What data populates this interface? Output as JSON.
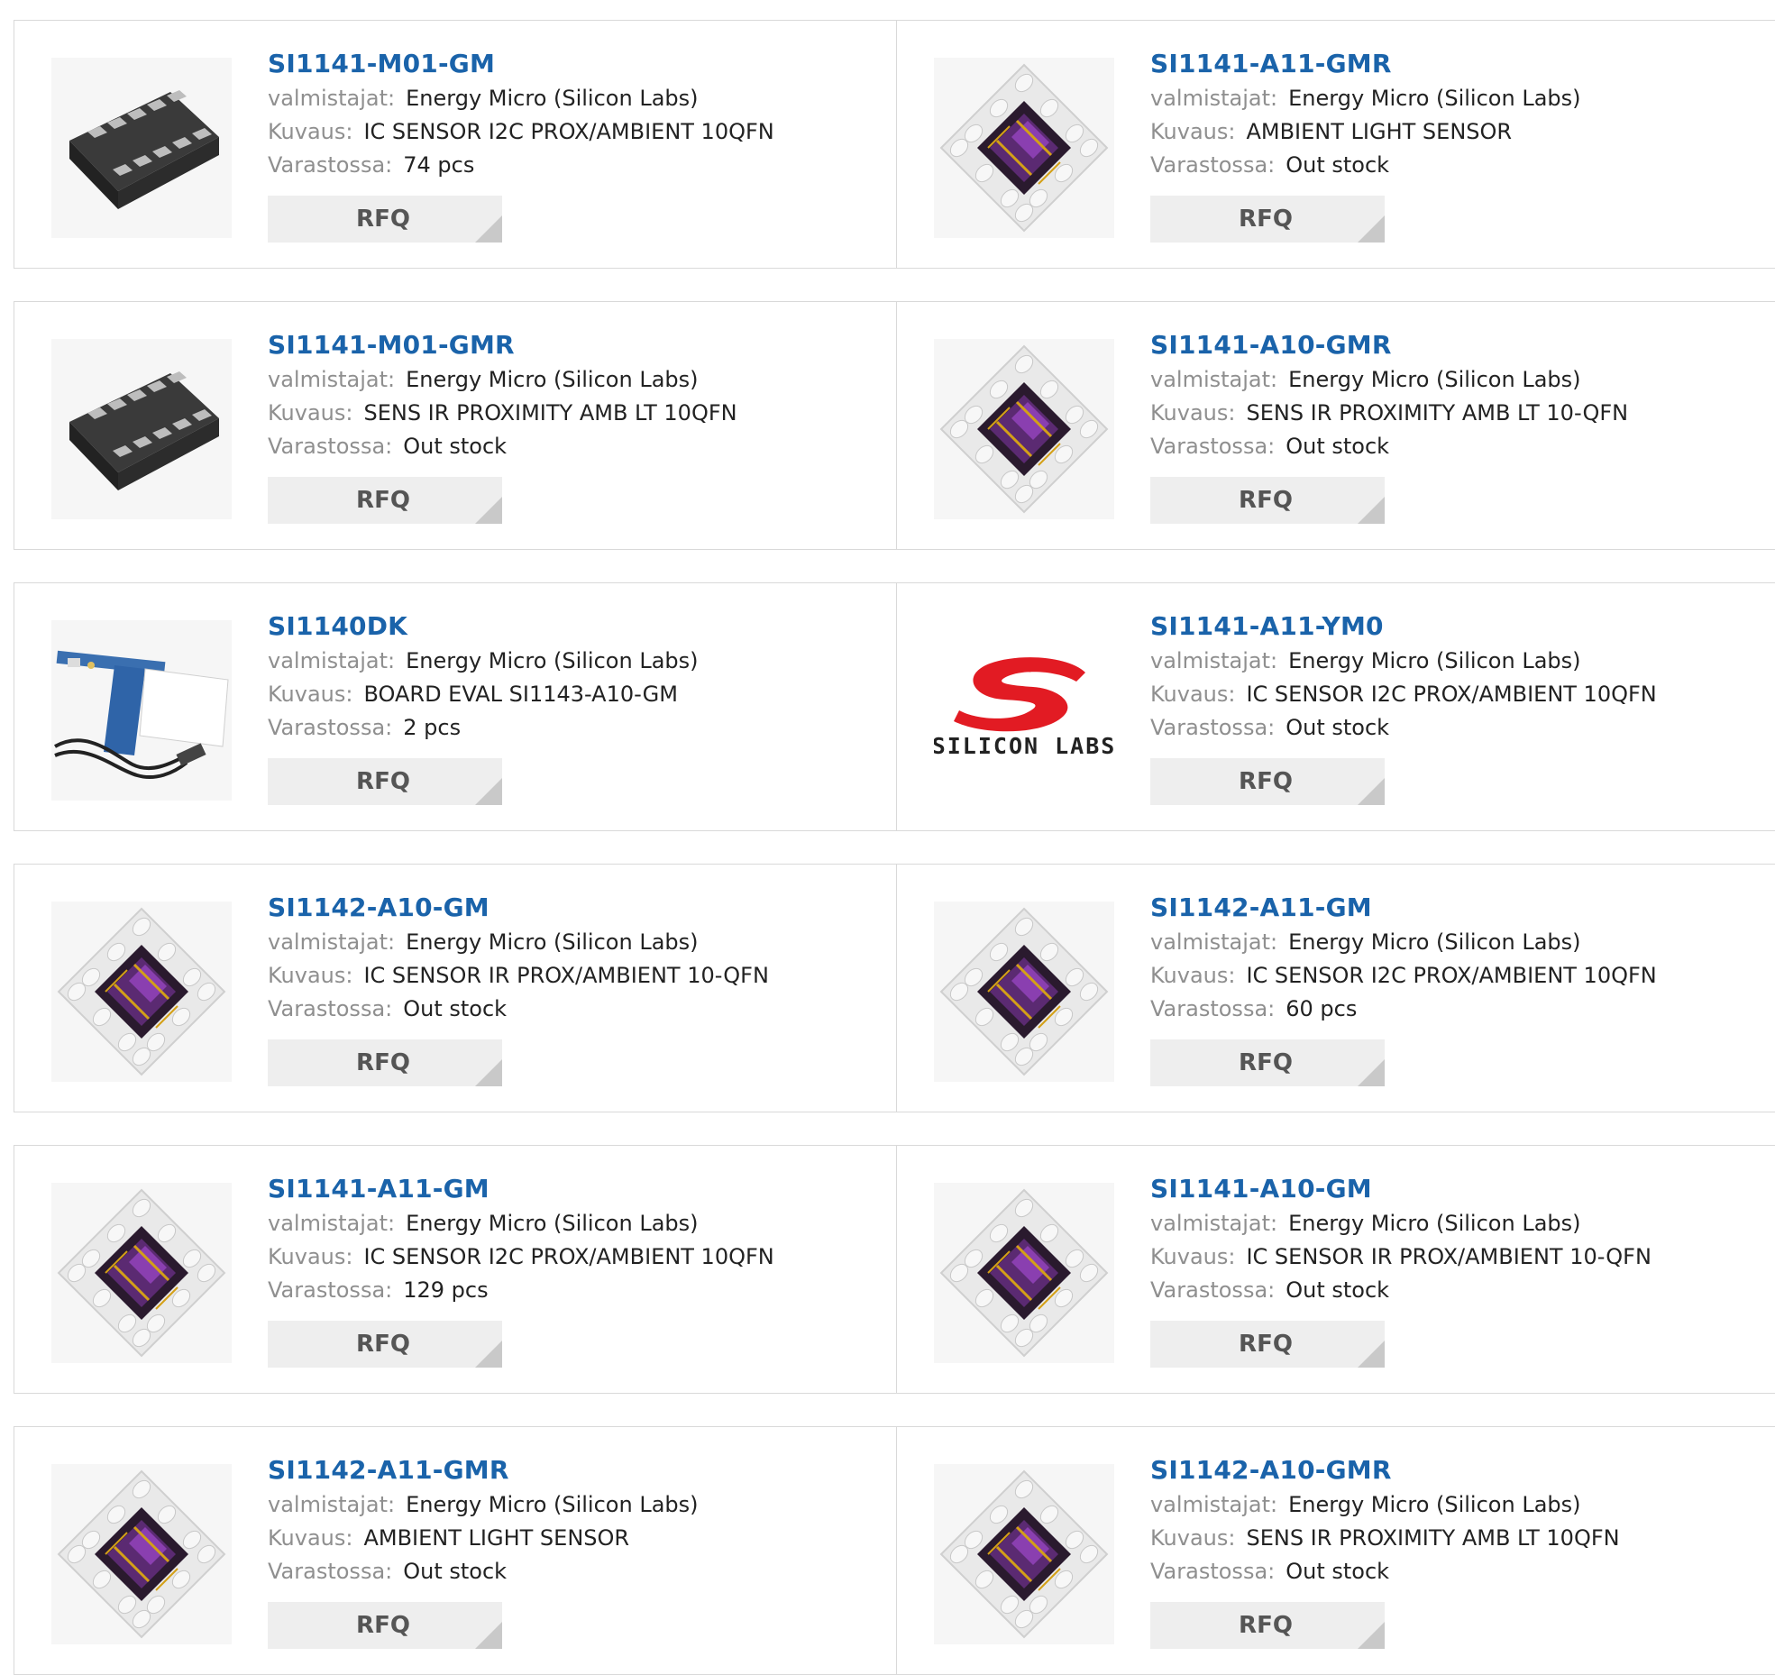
{
  "labels": {
    "manufacturer": "valmistajat:",
    "description": "Kuvaus:",
    "stock": "Varastossa:"
  },
  "colors": {
    "link": "#1a63aa",
    "label": "#8f8f8f",
    "button_bg": "#eeeeee",
    "border": "#d9d9d9"
  },
  "products": [
    {
      "pn": "SI1141-M01-GM",
      "mfr": "Energy Micro (Silicon Labs)",
      "desc": "IC SENSOR I2C PROX/AMBIENT 10QFN",
      "stock": "74 pcs",
      "rfq": "RFQ",
      "image": "qfn-black-package-image"
    },
    {
      "pn": "SI1141-A11-GMR",
      "mfr": "Energy Micro (Silicon Labs)",
      "desc": "AMBIENT LIGHT SENSOR",
      "stock": "Out stock",
      "rfq": "RFQ",
      "image": "sensor-chip-image"
    },
    {
      "pn": "SI1141-M01-GMR",
      "mfr": "Energy Micro (Silicon Labs)",
      "desc": "SENS IR PROXIMITY AMB LT 10QFN",
      "stock": "Out stock",
      "rfq": "RFQ",
      "image": "qfn-black-package-image"
    },
    {
      "pn": "SI1141-A10-GMR",
      "mfr": "Energy Micro (Silicon Labs)",
      "desc": "SENS IR PROXIMITY AMB LT 10-QFN",
      "stock": "Out stock",
      "rfq": "RFQ",
      "image": "sensor-chip-image"
    },
    {
      "pn": "SI1140DK",
      "mfr": "Energy Micro (Silicon Labs)",
      "desc": "BOARD EVAL SI1143-A10-GM",
      "stock": "2 pcs",
      "rfq": "RFQ",
      "image": "eval-board-image"
    },
    {
      "pn": "SI1141-A11-YM0",
      "mfr": "Energy Micro (Silicon Labs)",
      "desc": "IC SENSOR I2C PROX/AMBIENT 10QFN",
      "stock": "Out stock",
      "rfq": "RFQ",
      "image": "silicon-labs-logo",
      "logo_text": "SILICON LABS"
    },
    {
      "pn": "SI1142-A10-GM",
      "mfr": "Energy Micro (Silicon Labs)",
      "desc": "IC SENSOR IR PROX/AMBIENT 10-QFN",
      "stock": "Out stock",
      "rfq": "RFQ",
      "image": "sensor-chip-image"
    },
    {
      "pn": "SI1142-A11-GM",
      "mfr": "Energy Micro (Silicon Labs)",
      "desc": "IC SENSOR I2C PROX/AMBIENT 10QFN",
      "stock": "60 pcs",
      "rfq": "RFQ",
      "image": "sensor-chip-image"
    },
    {
      "pn": "SI1141-A11-GM",
      "mfr": "Energy Micro (Silicon Labs)",
      "desc": "IC SENSOR I2C PROX/AMBIENT 10QFN",
      "stock": "129 pcs",
      "rfq": "RFQ",
      "image": "sensor-chip-image"
    },
    {
      "pn": "SI1141-A10-GM",
      "mfr": "Energy Micro (Silicon Labs)",
      "desc": "IC SENSOR IR PROX/AMBIENT 10-QFN",
      "stock": "Out stock",
      "rfq": "RFQ",
      "image": "sensor-chip-image"
    },
    {
      "pn": "SI1142-A11-GMR",
      "mfr": "Energy Micro (Silicon Labs)",
      "desc": "AMBIENT LIGHT SENSOR",
      "stock": "Out stock",
      "rfq": "RFQ",
      "image": "sensor-chip-image"
    },
    {
      "pn": "SI1142-A10-GMR",
      "mfr": "Energy Micro (Silicon Labs)",
      "desc": "SENS IR PROXIMITY AMB LT 10QFN",
      "stock": "Out stock",
      "rfq": "RFQ",
      "image": "sensor-chip-image"
    }
  ]
}
